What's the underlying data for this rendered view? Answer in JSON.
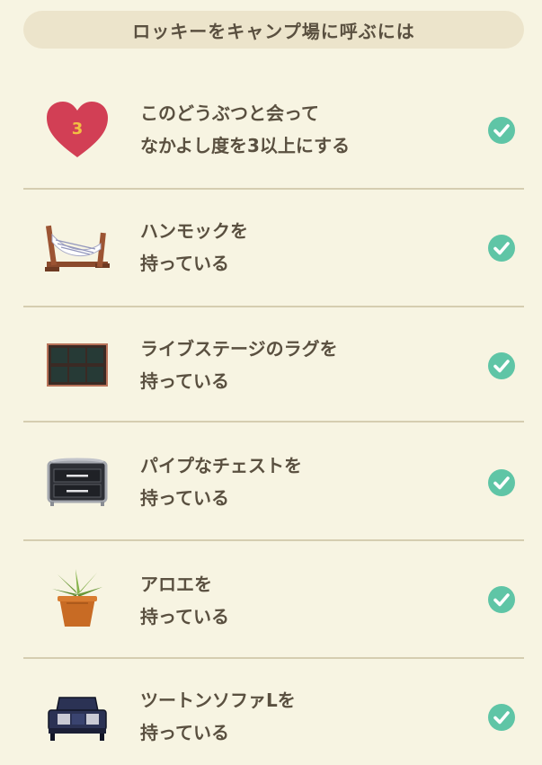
{
  "header": {
    "title": "ロッキーをキャンプ場に呼ぶには"
  },
  "requirements": [
    {
      "icon": "heart-icon",
      "badge": "3",
      "line1": "このどうぶつと会って",
      "line2": "なかよし度を3以上にする",
      "completed": true
    },
    {
      "icon": "hammock-icon",
      "line1": "ハンモックを",
      "line2": "持っている",
      "completed": true
    },
    {
      "icon": "stage-rug-icon",
      "line1": "ライブステージのラグを",
      "line2": "持っている",
      "completed": true
    },
    {
      "icon": "pipe-chest-icon",
      "line1": "パイプなチェストを",
      "line2": "持っている",
      "completed": true
    },
    {
      "icon": "aloe-plant-icon",
      "line1": "アロエを",
      "line2": "持っている",
      "completed": true
    },
    {
      "icon": "two-tone-sofa-icon",
      "line1": "ツートンソファLを",
      "line2": "持っている",
      "completed": true
    }
  ],
  "colors": {
    "background": "#f7f4e2",
    "header_bg": "#ece4cb",
    "text": "#5a5040",
    "divider": "#d5cdb0",
    "check": "#5fc5a6",
    "heart": "#d23f55",
    "heart_number": "#f2c043"
  }
}
